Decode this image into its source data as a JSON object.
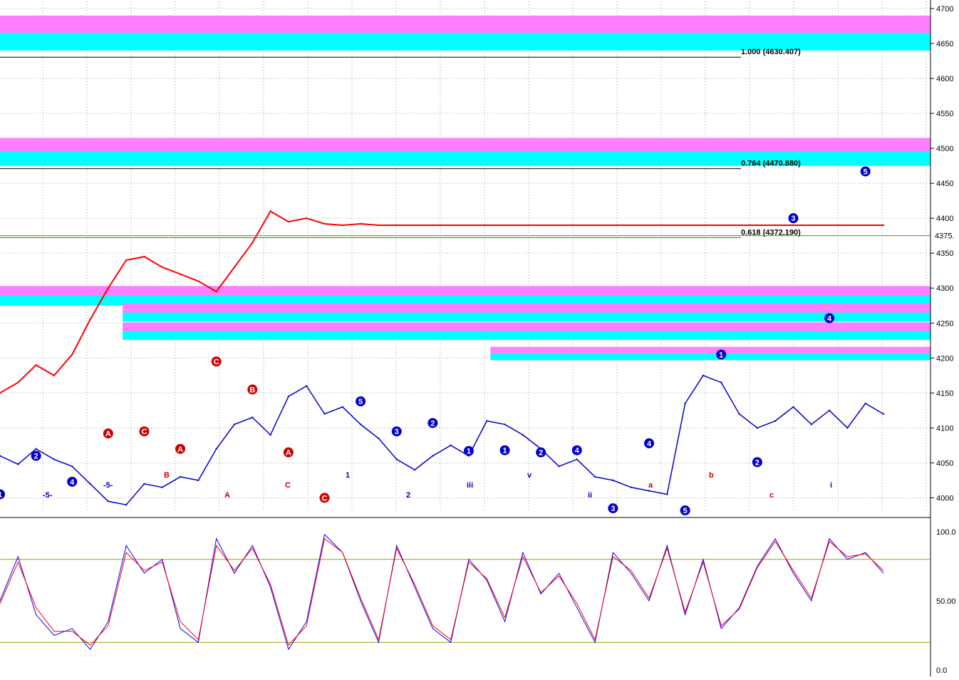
{
  "chart_data": [
    {
      "type": "line",
      "title": "",
      "xlabel": "",
      "ylabel": "",
      "ylim": [
        3980,
        4700
      ],
      "yticks": [
        4000,
        4050,
        4100,
        4150,
        4200,
        4250,
        4300,
        4350,
        4400,
        4450,
        4500,
        4550,
        4600,
        4650,
        4700
      ],
      "ytick_labels": [
        "4000",
        "4050",
        "4100",
        "4150",
        "4200",
        "4250",
        "4300",
        "4350",
        "4400",
        "4450",
        "4500",
        "4550",
        "4600",
        "4650",
        "4700"
      ],
      "last_price_label": "4375.",
      "grid": true,
      "x": [
        0,
        5,
        10,
        15,
        20,
        25,
        30,
        35,
        40,
        45,
        50,
        55,
        60,
        65,
        70,
        75,
        80,
        85,
        90,
        95,
        100,
        105,
        110,
        115,
        120,
        125,
        130,
        135,
        140,
        145,
        150,
        155,
        160,
        165,
        170,
        175,
        180,
        185,
        190,
        195,
        200,
        205,
        210,
        215,
        220,
        225,
        230,
        235,
        240,
        245
      ],
      "series": [
        {
          "values": [
            4060,
            4048,
            4070,
            4055,
            4045,
            4020,
            3995,
            3990,
            4020,
            4015,
            4030,
            4025,
            4070,
            4105,
            4115,
            4090,
            4145,
            4160,
            4120,
            4130,
            4105,
            4085,
            4055,
            4040,
            4060,
            4075,
            4060,
            4110,
            4105,
            4090,
            4070,
            4045,
            4055,
            4030,
            4025,
            4015,
            4010,
            4005,
            4135,
            4175,
            4165,
            4120,
            4100,
            4110,
            4130,
            4105,
            4125,
            4100,
            4135,
            4120
          ]
        },
        {
          "values": [
            4150,
            4165,
            4190,
            4175,
            4205,
            4255,
            4300,
            4340,
            4345,
            4330,
            4320,
            4310,
            4295,
            4330,
            4365,
            4410,
            4395,
            4400,
            4392,
            4390,
            4392,
            4390,
            4390,
            4390,
            4390,
            4390,
            4390,
            4390,
            4390,
            4390,
            4390,
            4390,
            4390,
            4390,
            4390,
            4390,
            4390,
            4390,
            4390,
            4390,
            4390,
            4390,
            4390,
            4390,
            4390,
            4390,
            4390,
            4390,
            4390,
            4390
          ]
        }
      ],
      "fib_levels": [
        {
          "ratio_label": "1.000 (4630.407)",
          "value": 4630.407
        },
        {
          "ratio_label": "0.764 (4470.880)",
          "value": 4470.88
        },
        {
          "ratio_label": "0.618 (4372.190)",
          "value": 4372.19
        }
      ],
      "zones": [
        {
          "from": 4640,
          "to": 4690,
          "color_top": "#ff80ff",
          "color_bottom": "#00ffff",
          "x_start": 0
        },
        {
          "from": 4475,
          "to": 4515,
          "color_top": "#ff80ff",
          "color_bottom": "#00ffff",
          "x_start": 0
        },
        {
          "from": 4275,
          "to": 4303,
          "color_top": "#ff80ff",
          "color_bottom": "#00ffff",
          "x_start": 0
        },
        {
          "from": 4252,
          "to": 4278,
          "color_top": "#ff80ff",
          "color_bottom": "#00ffff",
          "x_start": 34
        },
        {
          "from": 4226,
          "to": 4251,
          "color_top": "#ff80ff",
          "color_bottom": "#00ffff",
          "x_start": 34
        },
        {
          "from": 4197,
          "to": 4216,
          "color_top": "#ff80ff",
          "color_bottom": "#00ffff",
          "x_start": 136
        }
      ],
      "wave_labels": [
        {
          "t": "1",
          "price": 4005,
          "color": "#0000cc",
          "circle": true
        },
        {
          "t": "2",
          "price": 4060,
          "color": "#0000cc",
          "circle": true
        },
        {
          "t": "4",
          "price": 4023,
          "color": "#0000cc",
          "circle": true
        },
        {
          "t": "A",
          "price": 4092,
          "color": "#cc0000",
          "circle": true
        },
        {
          "t": "C",
          "price": 4095,
          "color": "#cc0000",
          "circle": true
        },
        {
          "t": "A",
          "price": 4070,
          "color": "#cc0000",
          "circle": true
        },
        {
          "t": "C",
          "price": 4195,
          "color": "#cc0000",
          "circle": true
        },
        {
          "t": "B",
          "price": 4155,
          "color": "#cc0000",
          "circle": true
        },
        {
          "t": "A",
          "price": 4065,
          "color": "#cc0000",
          "circle": true
        },
        {
          "t": "C",
          "price": 4000,
          "color": "#cc0000",
          "circle": true
        },
        {
          "t": "5",
          "price": 4138,
          "color": "#0000cc",
          "circle": true
        },
        {
          "t": "3",
          "price": 4095,
          "color": "#0000cc",
          "circle": true
        },
        {
          "t": "2",
          "price": 4107,
          "color": "#0000cc",
          "circle": true
        },
        {
          "t": "1",
          "price": 4067,
          "color": "#0000cc",
          "circle": true
        },
        {
          "t": "1",
          "price": 4068,
          "color": "#0000cc",
          "circle": true
        },
        {
          "t": "2",
          "price": 4065,
          "color": "#0000cc",
          "circle": true
        },
        {
          "t": "4",
          "price": 4068,
          "color": "#0000cc",
          "circle": true
        },
        {
          "t": "3",
          "price": 3985,
          "color": "#0000cc",
          "circle": true
        },
        {
          "t": "4",
          "price": 4078,
          "color": "#0000cc",
          "circle": true
        },
        {
          "t": "5",
          "price": 3982,
          "color": "#0000cc",
          "circle": true
        },
        {
          "t": "1",
          "price": 4205,
          "color": "#0000cc",
          "circle": true
        },
        {
          "t": "2",
          "price": 4051,
          "color": "#0000cc",
          "circle": true
        },
        {
          "t": "3",
          "price": 4400,
          "color": "#0000cc",
          "circle": true
        },
        {
          "t": "4",
          "price": 4257,
          "color": "#0000cc",
          "circle": true
        },
        {
          "t": "5",
          "price": 4467,
          "color": "#0000cc",
          "circle": true
        }
      ],
      "text_labels": [
        {
          "t": "-5-",
          "color": "#0000cc"
        },
        {
          "t": "-5-",
          "color": "#0000cc"
        },
        {
          "t": "B",
          "color": "#cc0000"
        },
        {
          "t": "A",
          "color": "#cc0000"
        },
        {
          "t": "C",
          "color": "#cc0000"
        },
        {
          "t": "1",
          "color": "#0000cc"
        },
        {
          "t": "2",
          "color": "#0000cc"
        },
        {
          "t": "iii",
          "color": "#0000cc"
        },
        {
          "t": "v",
          "color": "#0000cc"
        },
        {
          "t": "ii",
          "color": "#0000cc"
        },
        {
          "t": "a",
          "color": "#cc0000"
        },
        {
          "t": "b",
          "color": "#cc0000"
        },
        {
          "t": "c",
          "color": "#cc0000"
        },
        {
          "t": "i",
          "color": "#0000cc"
        }
      ]
    },
    {
      "type": "line",
      "title": "",
      "xlabel": "",
      "ylabel": "",
      "ylim": [
        0,
        100
      ],
      "yticks": [
        0,
        50,
        100
      ],
      "ytick_labels": [
        "0.0",
        "50.00",
        "100.0"
      ],
      "grid": false,
      "x": [
        0,
        5,
        10,
        15,
        20,
        25,
        30,
        35,
        40,
        45,
        50,
        55,
        60,
        65,
        70,
        75,
        80,
        85,
        90,
        95,
        100,
        105,
        110,
        115,
        120,
        125,
        130,
        135,
        140,
        145,
        150,
        155,
        160,
        165,
        170,
        175,
        180,
        185,
        190,
        195,
        200,
        205,
        210,
        215,
        220,
        225,
        230,
        235,
        240,
        245
      ],
      "series": [
        {
          "color": "#0000ff",
          "values": [
            50,
            82,
            40,
            25,
            30,
            15,
            35,
            90,
            70,
            80,
            30,
            20,
            95,
            70,
            90,
            60,
            15,
            35,
            98,
            85,
            50,
            20,
            90,
            60,
            30,
            20,
            80,
            65,
            35,
            85,
            55,
            70,
            45,
            20,
            85,
            70,
            50,
            90,
            40,
            80,
            30,
            45,
            75,
            95,
            70,
            50,
            95,
            80,
            85,
            70
          ]
        },
        {
          "color": "#ff0000",
          "values": [
            48,
            78,
            45,
            28,
            28,
            18,
            32,
            85,
            72,
            78,
            35,
            22,
            90,
            72,
            88,
            62,
            18,
            32,
            95,
            85,
            52,
            22,
            88,
            62,
            32,
            22,
            78,
            66,
            38,
            82,
            56,
            68,
            48,
            22,
            82,
            72,
            52,
            88,
            42,
            78,
            32,
            44,
            74,
            93,
            72,
            52,
            93,
            82,
            84,
            72
          ]
        }
      ]
    }
  ]
}
